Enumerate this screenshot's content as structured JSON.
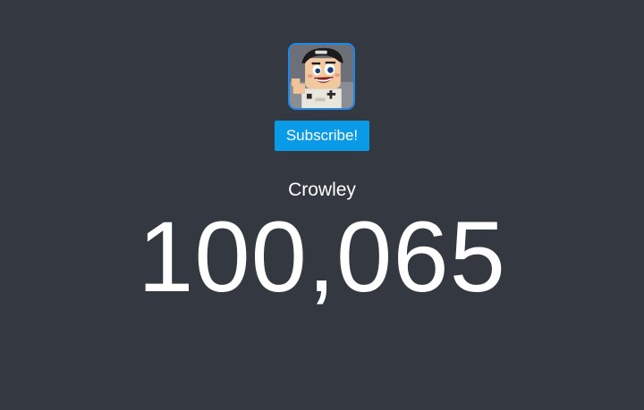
{
  "channel": {
    "avatar_icon": "minecraft-avatar-icon",
    "name": "Crowley",
    "subscriber_count": "100,065"
  },
  "actions": {
    "subscribe_label": "Subscribe!"
  },
  "colors": {
    "background": "#343841",
    "subscribe_button": "#0a9be8",
    "avatar_border": "#1e88e5",
    "text": "#ffffff"
  }
}
